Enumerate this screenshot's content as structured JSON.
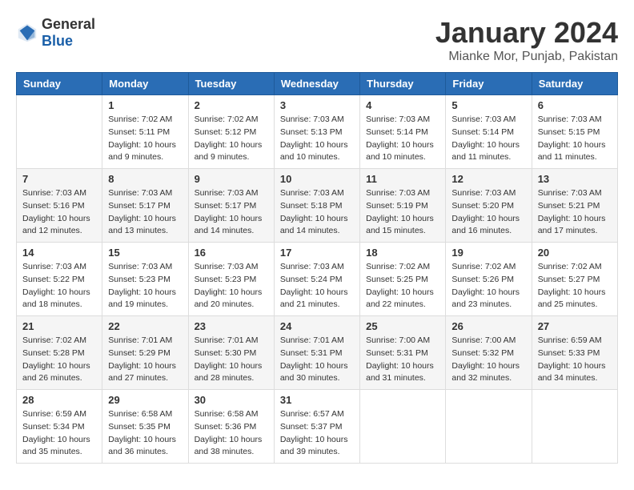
{
  "logo": {
    "general": "General",
    "blue": "Blue"
  },
  "header": {
    "month": "January 2024",
    "location": "Mianke Mor, Punjab, Pakistan"
  },
  "weekdays": [
    "Sunday",
    "Monday",
    "Tuesday",
    "Wednesday",
    "Thursday",
    "Friday",
    "Saturday"
  ],
  "weeks": [
    [
      {
        "day": "",
        "info": ""
      },
      {
        "day": "1",
        "info": "Sunrise: 7:02 AM\nSunset: 5:11 PM\nDaylight: 10 hours\nand 9 minutes."
      },
      {
        "day": "2",
        "info": "Sunrise: 7:02 AM\nSunset: 5:12 PM\nDaylight: 10 hours\nand 9 minutes."
      },
      {
        "day": "3",
        "info": "Sunrise: 7:03 AM\nSunset: 5:13 PM\nDaylight: 10 hours\nand 10 minutes."
      },
      {
        "day": "4",
        "info": "Sunrise: 7:03 AM\nSunset: 5:14 PM\nDaylight: 10 hours\nand 10 minutes."
      },
      {
        "day": "5",
        "info": "Sunrise: 7:03 AM\nSunset: 5:14 PM\nDaylight: 10 hours\nand 11 minutes."
      },
      {
        "day": "6",
        "info": "Sunrise: 7:03 AM\nSunset: 5:15 PM\nDaylight: 10 hours\nand 11 minutes."
      }
    ],
    [
      {
        "day": "7",
        "info": "Sunrise: 7:03 AM\nSunset: 5:16 PM\nDaylight: 10 hours\nand 12 minutes."
      },
      {
        "day": "8",
        "info": "Sunrise: 7:03 AM\nSunset: 5:17 PM\nDaylight: 10 hours\nand 13 minutes."
      },
      {
        "day": "9",
        "info": "Sunrise: 7:03 AM\nSunset: 5:17 PM\nDaylight: 10 hours\nand 14 minutes."
      },
      {
        "day": "10",
        "info": "Sunrise: 7:03 AM\nSunset: 5:18 PM\nDaylight: 10 hours\nand 14 minutes."
      },
      {
        "day": "11",
        "info": "Sunrise: 7:03 AM\nSunset: 5:19 PM\nDaylight: 10 hours\nand 15 minutes."
      },
      {
        "day": "12",
        "info": "Sunrise: 7:03 AM\nSunset: 5:20 PM\nDaylight: 10 hours\nand 16 minutes."
      },
      {
        "day": "13",
        "info": "Sunrise: 7:03 AM\nSunset: 5:21 PM\nDaylight: 10 hours\nand 17 minutes."
      }
    ],
    [
      {
        "day": "14",
        "info": "Sunrise: 7:03 AM\nSunset: 5:22 PM\nDaylight: 10 hours\nand 18 minutes."
      },
      {
        "day": "15",
        "info": "Sunrise: 7:03 AM\nSunset: 5:23 PM\nDaylight: 10 hours\nand 19 minutes."
      },
      {
        "day": "16",
        "info": "Sunrise: 7:03 AM\nSunset: 5:23 PM\nDaylight: 10 hours\nand 20 minutes."
      },
      {
        "day": "17",
        "info": "Sunrise: 7:03 AM\nSunset: 5:24 PM\nDaylight: 10 hours\nand 21 minutes."
      },
      {
        "day": "18",
        "info": "Sunrise: 7:02 AM\nSunset: 5:25 PM\nDaylight: 10 hours\nand 22 minutes."
      },
      {
        "day": "19",
        "info": "Sunrise: 7:02 AM\nSunset: 5:26 PM\nDaylight: 10 hours\nand 23 minutes."
      },
      {
        "day": "20",
        "info": "Sunrise: 7:02 AM\nSunset: 5:27 PM\nDaylight: 10 hours\nand 25 minutes."
      }
    ],
    [
      {
        "day": "21",
        "info": "Sunrise: 7:02 AM\nSunset: 5:28 PM\nDaylight: 10 hours\nand 26 minutes."
      },
      {
        "day": "22",
        "info": "Sunrise: 7:01 AM\nSunset: 5:29 PM\nDaylight: 10 hours\nand 27 minutes."
      },
      {
        "day": "23",
        "info": "Sunrise: 7:01 AM\nSunset: 5:30 PM\nDaylight: 10 hours\nand 28 minutes."
      },
      {
        "day": "24",
        "info": "Sunrise: 7:01 AM\nSunset: 5:31 PM\nDaylight: 10 hours\nand 30 minutes."
      },
      {
        "day": "25",
        "info": "Sunrise: 7:00 AM\nSunset: 5:31 PM\nDaylight: 10 hours\nand 31 minutes."
      },
      {
        "day": "26",
        "info": "Sunrise: 7:00 AM\nSunset: 5:32 PM\nDaylight: 10 hours\nand 32 minutes."
      },
      {
        "day": "27",
        "info": "Sunrise: 6:59 AM\nSunset: 5:33 PM\nDaylight: 10 hours\nand 34 minutes."
      }
    ],
    [
      {
        "day": "28",
        "info": "Sunrise: 6:59 AM\nSunset: 5:34 PM\nDaylight: 10 hours\nand 35 minutes."
      },
      {
        "day": "29",
        "info": "Sunrise: 6:58 AM\nSunset: 5:35 PM\nDaylight: 10 hours\nand 36 minutes."
      },
      {
        "day": "30",
        "info": "Sunrise: 6:58 AM\nSunset: 5:36 PM\nDaylight: 10 hours\nand 38 minutes."
      },
      {
        "day": "31",
        "info": "Sunrise: 6:57 AM\nSunset: 5:37 PM\nDaylight: 10 hours\nand 39 minutes."
      },
      {
        "day": "",
        "info": ""
      },
      {
        "day": "",
        "info": ""
      },
      {
        "day": "",
        "info": ""
      }
    ]
  ]
}
